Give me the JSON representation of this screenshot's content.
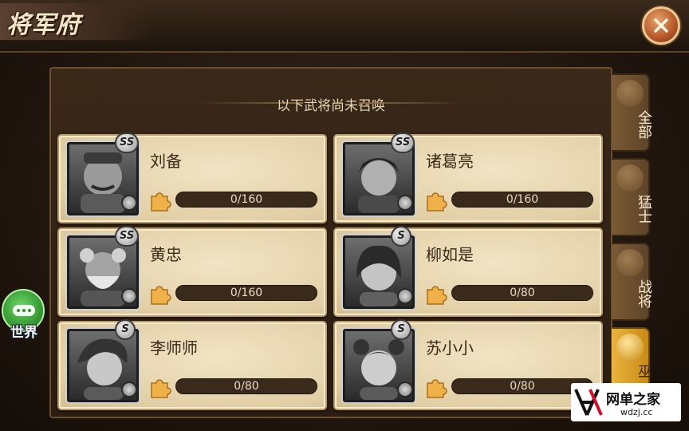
{
  "header": {
    "title": "将军府",
    "close_icon": "close-icon"
  },
  "panel": {
    "subtitle": "以下武将尚未召唤"
  },
  "heroes": [
    {
      "name": "刘备",
      "rank": "SS",
      "progress_text": "0/160",
      "progress": 0
    },
    {
      "name": "诸葛亮",
      "rank": "SS",
      "progress_text": "0/160",
      "progress": 0
    },
    {
      "name": "黄忠",
      "rank": "SS",
      "progress_text": "0/160",
      "progress": 0
    },
    {
      "name": "柳如是",
      "rank": "S",
      "progress_text": "0/80",
      "progress": 0
    },
    {
      "name": "李师师",
      "rank": "S",
      "progress_text": "0/80",
      "progress": 0
    },
    {
      "name": "苏小小",
      "rank": "S",
      "progress_text": "0/80",
      "progress": 0
    }
  ],
  "tabs": [
    {
      "label": "全部",
      "active": false
    },
    {
      "label": "猛士",
      "active": false
    },
    {
      "label": "战将",
      "active": false
    },
    {
      "label": "巫",
      "active": true
    }
  ],
  "chat": {
    "label": "世界"
  },
  "watermark": {
    "brand": "网单之家",
    "domain": "wdzj.cc"
  },
  "colors": {
    "accent": "#e9b43c",
    "chat": "#2e8f2c",
    "close": "#b5572a"
  }
}
